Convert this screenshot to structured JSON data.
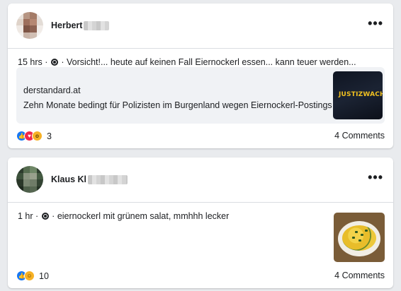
{
  "posts": [
    {
      "author_first": "Herbert",
      "author_blurred": true,
      "time": "15 hrs",
      "audience_icon": "globe-icon",
      "text": "Vorsicht!... heute auf keinen Fall Eiernockerl essen... kann teuer werden...",
      "link": {
        "domain": "derstandard.at",
        "title": "Zehn Monate bedingt für Polizisten im Burgenland wegen Eiernockerl-Postings",
        "thumb_label": "JUSTIZWACHE"
      },
      "reaction_icons": [
        "like-icon",
        "love-icon",
        "wow-icon"
      ],
      "reaction_count": "3",
      "comments": "4 Comments"
    },
    {
      "author_first": "Klaus Kl",
      "author_blurred": true,
      "time": "1 hr",
      "audience_icon": "globe-icon",
      "text": "eiernockerl mit grünem salat, mmhhh lecker",
      "reaction_icons": [
        "like-icon",
        "haha-icon"
      ],
      "reaction_count": "10",
      "comments": "4 Comments"
    }
  ],
  "colors": {
    "page_bg": "#e9ebee",
    "card_bg": "#ffffff",
    "like_blue": "#1877f2",
    "love_red": "#f02849",
    "reaction_yellow": "#f7b125"
  }
}
